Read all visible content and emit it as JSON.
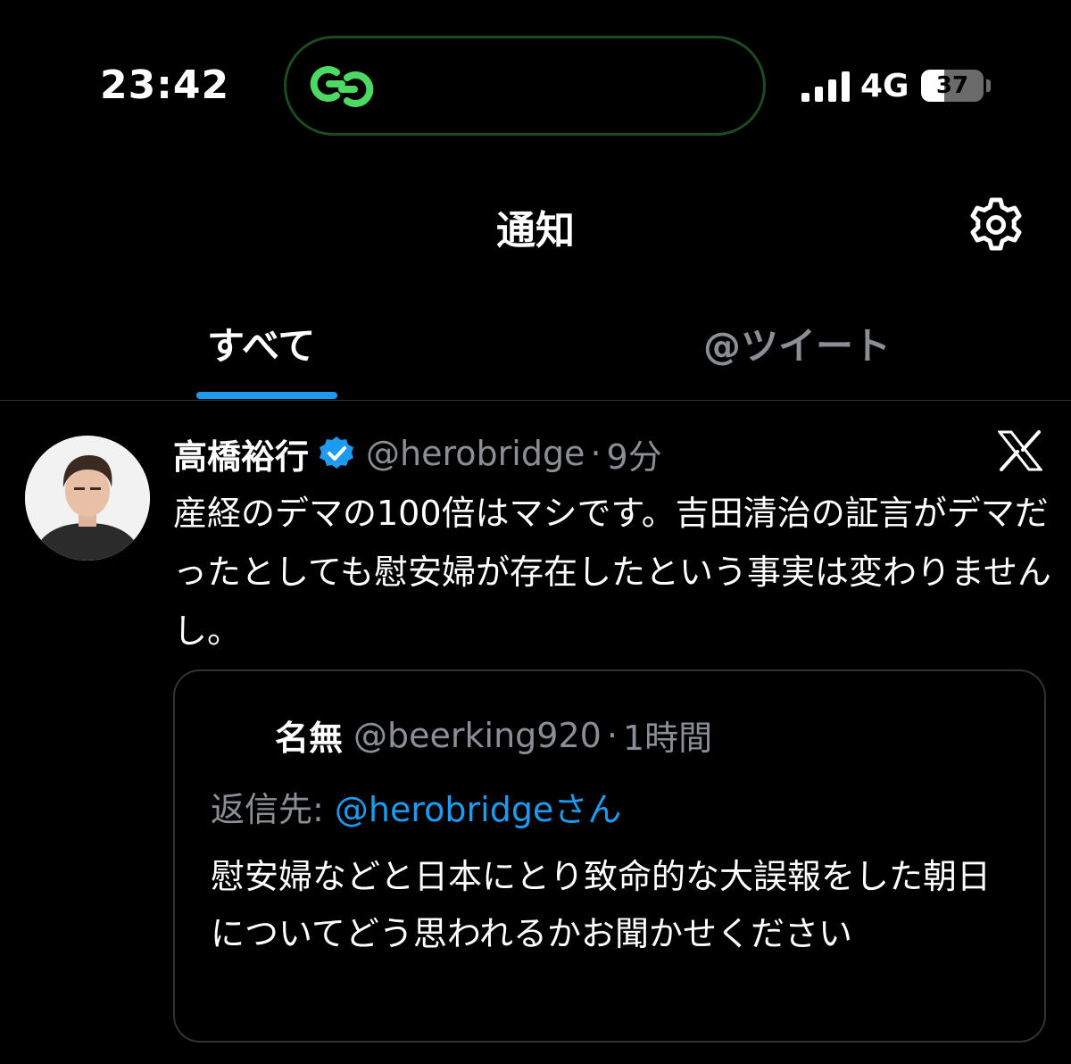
{
  "status_bar": {
    "time": "23:42",
    "network": "4G",
    "battery_level": "37",
    "battery_fraction": 0.37
  },
  "header": {
    "title": "通知",
    "settings_icon": "gear-icon"
  },
  "tabs": [
    {
      "label": "すべて",
      "active": true
    },
    {
      "label": "@ツイート",
      "active": false
    }
  ],
  "tweet": {
    "name": "高橋裕行",
    "handle": "@herobridge",
    "separator": "·",
    "time_ago": "9分",
    "text": "産経のデマの100倍はマシです。吉田清治の証言がデマだったとしても慰安婦が存在したという事実は変わりませんし。",
    "quote": {
      "name": "名無",
      "handle": "@beerking920",
      "separator": "·",
      "time_ago": "1時間",
      "reply_label": "返信先: ",
      "reply_handle": "@herobridgeさん",
      "text": "慰安婦などと日本にとり致命的な大誤報をした朝日についてどう思われるかお聞かせください"
    }
  },
  "colors": {
    "background": "#000000",
    "accent": "#1d9bf0",
    "muted": "#8b8f95",
    "island_icon": "#4cd964"
  }
}
